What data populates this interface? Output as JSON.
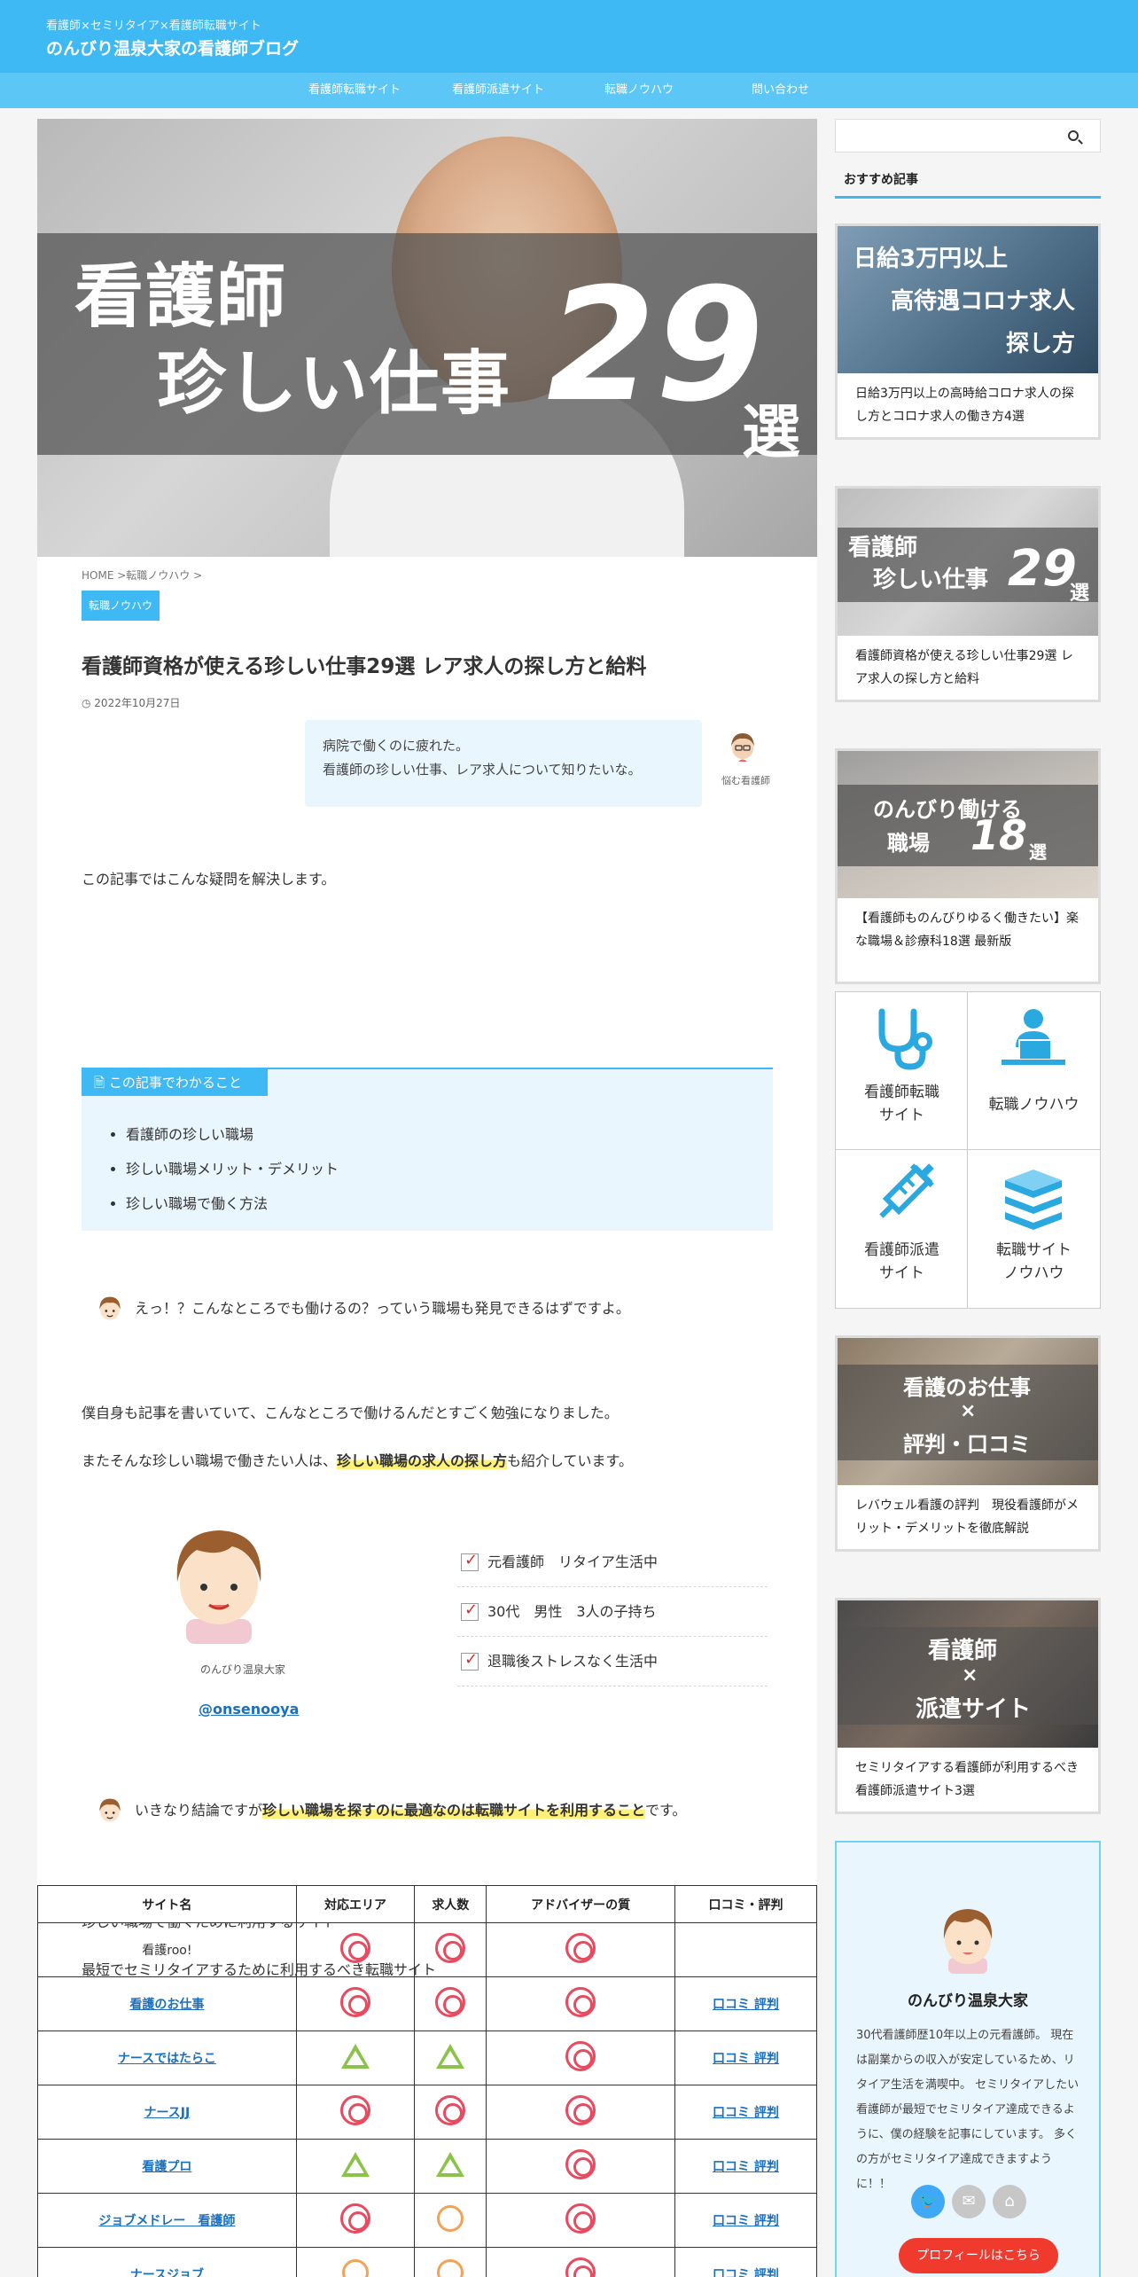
{
  "header": {
    "tagline": "看護師×セミリタイア×看護師転職サイト",
    "site_title": "のんびり温泉大家の看護師ブログ",
    "nav": [
      "看護師転職サイト",
      "看護師派遣サイト",
      "転職ノウハウ",
      "問い合わせ"
    ]
  },
  "hero": {
    "line1": "看護師",
    "line2": "珍しい仕事",
    "number": "29",
    "suffix": "選"
  },
  "article": {
    "breadcrumb": "HOME >転職ノウハウ >",
    "category": "転職ノウハウ",
    "title": "看護師資格が使える珍しい仕事29選 レア求人の探し方と給料",
    "date": "2022年10月27日",
    "speech1": {
      "lines": [
        "病院で働くのに疲れた。",
        "看護師の珍しい仕事、レア求人について知りたいな。"
      ],
      "speaker": "悩む看護師"
    },
    "intro": "この記事ではこんな疑問を解決します。",
    "summary": {
      "heading": "この記事でわかること",
      "items": [
        "看護師の珍しい職場",
        "珍しい職場メリット・デメリット",
        "珍しい職場で働く方法"
      ]
    },
    "speech2": "えっ！？こんなところでも働けるの？っていう職場も発見できるはずですよ。",
    "para1": "僕自身も記事を書いていて、こんなところで働けるんだとすごく勉強になりました。",
    "para2_pre": "またそんな珍しい職場で働きたい人は、",
    "para2_mark": "珍しい職場の求人の探し方",
    "para2_post": "も紹介しています。",
    "profile": {
      "name": "のんびり温泉大家",
      "handle": "@onsenooya",
      "checks": [
        "元看護師　リタイア生活中",
        "30代　男性　3人の子持ち",
        "退職後ストレスなく生活中"
      ]
    },
    "speech3_pre": "いきなり結論ですが",
    "speech3_mark": "珍しい職場を探すのに最適なのは転職サイトを利用すること",
    "speech3_post": "です。",
    "para3": "珍しい職場で働くために利用するサイト",
    "para4": "最短でセミリタイアするために利用するべき転職サイト",
    "table": {
      "headers": [
        "サイト名",
        "対応エリア",
        "求人数",
        "アドバイザーの質",
        "口コミ・評判"
      ],
      "rows": [
        {
          "site": "看護roo!",
          "link": false,
          "area": "double",
          "jobs": "double",
          "advisor": "double",
          "review": ""
        },
        {
          "site": "看護のお仕事",
          "link": true,
          "area": "double",
          "jobs": "double",
          "advisor": "double",
          "review": "口コミ 評判"
        },
        {
          "site": "ナースではたらこ",
          "link": true,
          "area": "triangle",
          "jobs": "triangle",
          "advisor": "double",
          "review": "口コミ 評判"
        },
        {
          "site": "ナースJJ",
          "link": true,
          "area": "double",
          "jobs": "double",
          "advisor": "double",
          "review": "口コミ 評判"
        },
        {
          "site": "看護プロ",
          "link": true,
          "area": "triangle",
          "jobs": "triangle",
          "advisor": "double",
          "review": "口コミ 評判"
        },
        {
          "site": "ジョブメドレー　看護師",
          "link": true,
          "area": "double",
          "jobs": "single",
          "advisor": "double",
          "review": "口コミ 評判"
        },
        {
          "site": "ナースジョブ",
          "link": true,
          "area": "single",
          "jobs": "single",
          "advisor": "double",
          "review": "口コミ 評判"
        }
      ]
    }
  },
  "sidebar": {
    "search_placeholder": "",
    "widget_title": "おすすめ記事",
    "cards": [
      {
        "thumb_lines": [
          "日給3万円以上",
          "高待遇コロナ求人",
          "探し方"
        ],
        "caption": "日給3万円以上の高時給コロナ求人の探し方とコロナ求人の働き方4選"
      },
      {
        "thumb_lines": [
          "看護師",
          "珍しい仕事",
          "29",
          "選"
        ],
        "caption": "看護師資格が使える珍しい仕事29選 レア求人の探し方と給料"
      },
      {
        "thumb_lines": [
          "のんびり働ける",
          "職場",
          "18",
          "選"
        ],
        "caption": "【看護師ものんびりゆるく働きたい】楽な職場＆診療科18選 最新版"
      }
    ],
    "icon_grid": [
      {
        "label": "看護師転職\nサイト",
        "icon": "stethoscope-icon"
      },
      {
        "label": "転職ノウハウ",
        "icon": "laptop-user-icon"
      },
      {
        "label": "看護師派遣\nサイト",
        "icon": "syringe-icon"
      },
      {
        "label": "転職サイト\nノウハウ",
        "icon": "books-icon"
      }
    ],
    "cards2": [
      {
        "thumb_lines": [
          "看護のお仕事",
          "×",
          "評判・口コミ"
        ],
        "caption": "レバウェル看護の評判　現役看護師がメリット・デメリットを徹底解説"
      },
      {
        "thumb_lines": [
          "看護師",
          "×",
          "派遣サイト"
        ],
        "caption": "セミリタイアする看護師が利用するべき看護師派遣サイト3選"
      }
    ],
    "profile": {
      "name": "のんびり温泉大家",
      "bio": "30代看護師歴10年以上の元看護師。 現在は副業からの収入が安定しているため、リタイア生活を満喫中。 セミリタイアしたい看護師が最短でセミリタイア達成できるように、僕の経験を記事にしています。 多くの方がセミリタイア達成できますように！！",
      "button": "プロフィールはこちら"
    }
  },
  "colors": {
    "brand": "#3fb9f3",
    "accent_red": "#e84a5f",
    "button_red": "#f03a2e"
  }
}
